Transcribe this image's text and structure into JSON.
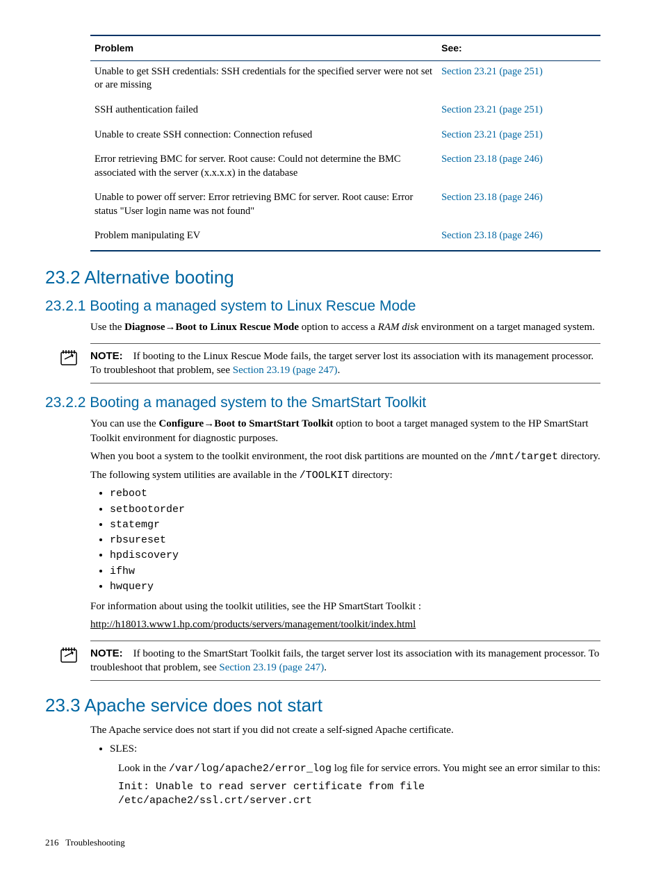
{
  "table": {
    "headers": {
      "problem": "Problem",
      "see": "See:"
    },
    "rows": [
      {
        "problem": "Unable to get SSH credentials: SSH credentials for the specified server were not set or are missing",
        "see": "Section 23.21 (page 251)"
      },
      {
        "problem": "SSH authentication failed",
        "see": "Section 23.21 (page 251)"
      },
      {
        "problem": "Unable to create SSH connection: Connection refused",
        "see": "Section 23.21 (page 251)"
      },
      {
        "problem": "Error retrieving BMC for server. Root cause: Could not determine the BMC associated with the server (x.x.x.x) in the database",
        "see": "Section 23.18 (page 246)"
      },
      {
        "problem": "Unable to power off server: Error retrieving BMC for server. Root cause: Error status \"User login name was not found\"",
        "see": "Section 23.18 (page 246)"
      },
      {
        "problem": "Problem manipulating EV",
        "see": "Section 23.18 (page 246)"
      }
    ]
  },
  "s232": {
    "title": "23.2 Alternative booting",
    "s2321": {
      "title": "23.2.1 Booting a managed system to Linux Rescue Mode",
      "p1_a": "Use the ",
      "p1_b": "Diagnose",
      "p1_arrow": "→",
      "p1_c": "Boot to Linux Rescue Mode",
      "p1_d": " option to access a ",
      "p1_e": "RAM disk",
      "p1_f": " environment on a target managed system.",
      "note_label": "NOTE:",
      "note_a": "If booting to the Linux Rescue Mode fails, the target server lost its association with its management processor. To troubleshoot that problem, see ",
      "note_link": "Section 23.19 (page 247)",
      "note_b": "."
    },
    "s2322": {
      "title": "23.2.2 Booting a managed system to the SmartStart Toolkit",
      "p1_a": "You can use the ",
      "p1_b": "Configure",
      "p1_arrow": "→",
      "p1_c": "Boot to SmartStart Toolkit",
      "p1_d": " option to boot a target managed system to the HP SmartStart Toolkit environment for diagnostic purposes.",
      "p2_a": "When you boot a system to the toolkit environment, the root disk partitions are mounted on the ",
      "p2_b": "/mnt/target",
      "p2_c": " directory.",
      "p3_a": "The following system utilities are available in the ",
      "p3_b": "/TOOLKIT",
      "p3_c": " directory:",
      "utils": [
        "reboot",
        "setbootorder",
        "statemgr",
        "rbsureset",
        "hpdiscovery",
        "ifhw",
        "hwquery"
      ],
      "p4": "For information about using the toolkit utilities, see the HP SmartStart Toolkit :",
      "url": "http://h18013.www1.hp.com/products/servers/management/toolkit/index.html",
      "note_label": "NOTE:",
      "note_a": "If booting to the SmartStart Toolkit fails, the target server lost its association with its management processor. To troubleshoot that problem, see ",
      "note_link": "Section 23.19 (page 247)",
      "note_b": "."
    }
  },
  "s233": {
    "title": "23.3 Apache service does not start",
    "p1": "The Apache service does not start if you did not create a self-signed Apache certificate.",
    "bullet1": "SLES:",
    "p2_a": "Look in the ",
    "p2_b": "/var/log/apache2/error_log",
    "p2_c": " log file for service errors. You might see an error similar to this:",
    "code": "Init: Unable to read server certificate from file /etc/apache2/ssl.crt/server.crt"
  },
  "footer": {
    "page": "216",
    "title": "Troubleshooting"
  }
}
